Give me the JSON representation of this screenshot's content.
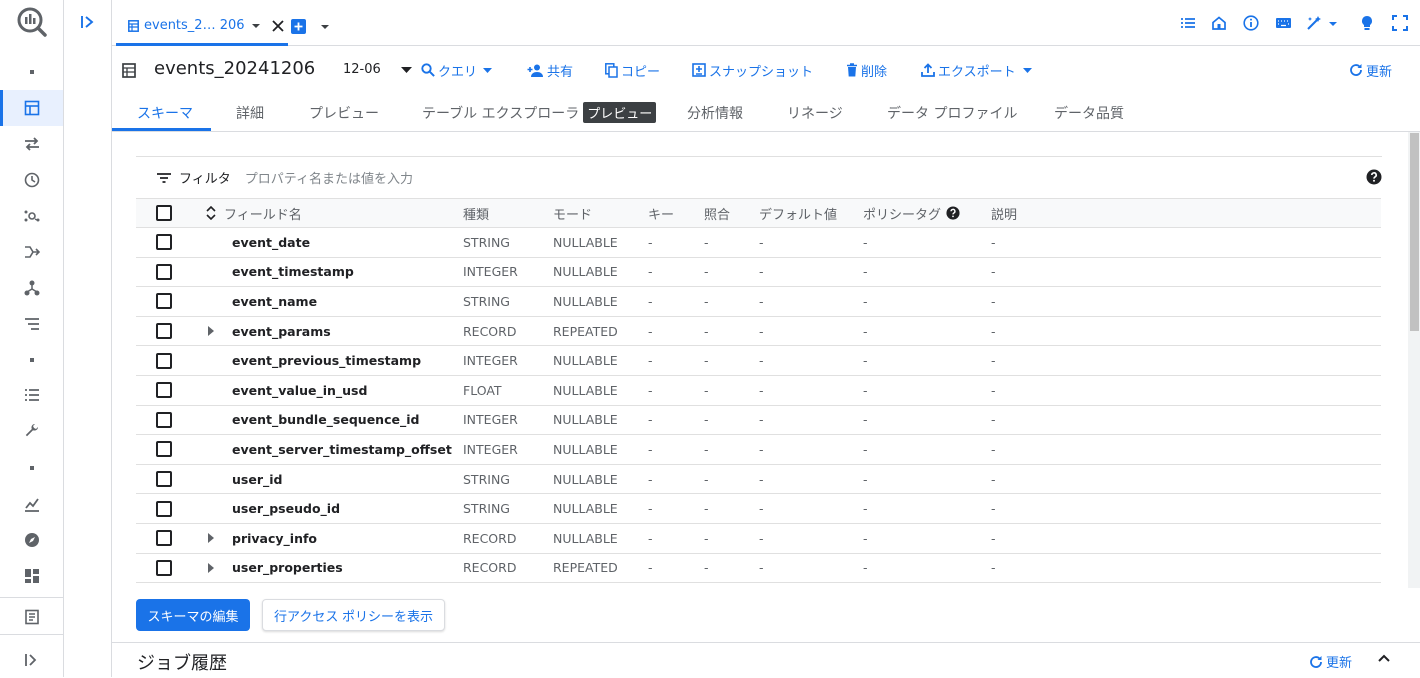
{
  "tab": {
    "label": "events_2… 206"
  },
  "toolbar": {
    "title": "events_20241206",
    "partition": "12-06",
    "query": "クエリ",
    "share": "共有",
    "copy": "コピー",
    "snapshot": "スナップショット",
    "delete": "削除",
    "export": "エクスポート",
    "refresh": "更新"
  },
  "subtabs": [
    "スキーマ",
    "詳細",
    "プレビュー",
    "テーブル エクスプローラ",
    "分析情報",
    "リネージ",
    "データ プロファイル",
    "データ品質"
  ],
  "preview_badge": "プレビュー",
  "filter": {
    "label": "フィルタ",
    "placeholder": "プロパティ名または値を入力"
  },
  "table": {
    "headers": [
      "フィールド名",
      "種類",
      "モード",
      "キー",
      "照合",
      "デフォルト値",
      "ポリシータグ",
      "説明"
    ],
    "rows": [
      {
        "name": "event_date",
        "type": "STRING",
        "mode": "NULLABLE",
        "expandable": false
      },
      {
        "name": "event_timestamp",
        "type": "INTEGER",
        "mode": "NULLABLE",
        "expandable": false
      },
      {
        "name": "event_name",
        "type": "STRING",
        "mode": "NULLABLE",
        "expandable": false
      },
      {
        "name": "event_params",
        "type": "RECORD",
        "mode": "REPEATED",
        "expandable": true
      },
      {
        "name": "event_previous_timestamp",
        "type": "INTEGER",
        "mode": "NULLABLE",
        "expandable": false
      },
      {
        "name": "event_value_in_usd",
        "type": "FLOAT",
        "mode": "NULLABLE",
        "expandable": false
      },
      {
        "name": "event_bundle_sequence_id",
        "type": "INTEGER",
        "mode": "NULLABLE",
        "expandable": false
      },
      {
        "name": "event_server_timestamp_offset",
        "type": "INTEGER",
        "mode": "NULLABLE",
        "expandable": false
      },
      {
        "name": "user_id",
        "type": "STRING",
        "mode": "NULLABLE",
        "expandable": false
      },
      {
        "name": "user_pseudo_id",
        "type": "STRING",
        "mode": "NULLABLE",
        "expandable": false
      },
      {
        "name": "privacy_info",
        "type": "RECORD",
        "mode": "NULLABLE",
        "expandable": true
      },
      {
        "name": "user_properties",
        "type": "RECORD",
        "mode": "REPEATED",
        "expandable": true
      }
    ],
    "empty": "-"
  },
  "buttons": {
    "edit_schema": "スキーマの編集",
    "row_access": "行アクセス ポリシーを表示"
  },
  "job_history": {
    "title": "ジョブ履歴",
    "refresh": "更新"
  },
  "colors": {
    "accent": "#1a73e8",
    "border": "#dadce0"
  }
}
